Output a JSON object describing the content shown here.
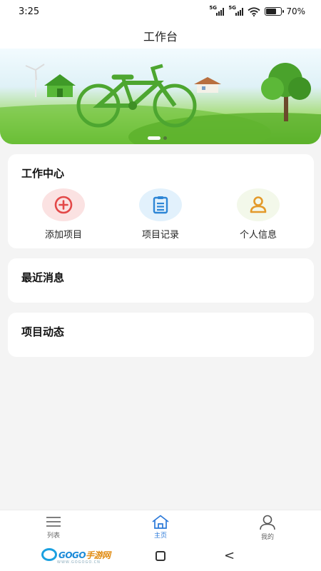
{
  "status": {
    "time": "3:25",
    "net1": "5G",
    "net2": "5G",
    "battery": "70%",
    "battery_level": 0.7
  },
  "header": {
    "title": "工作台"
  },
  "banner": {
    "slides": 2,
    "active_slide": 1
  },
  "work_center": {
    "title": "工作中心",
    "items": [
      {
        "label": "添加项目",
        "icon": "add-circle-icon",
        "bg": "#fbe2e2",
        "color": "#e34848"
      },
      {
        "label": "项目记录",
        "icon": "document-list-icon",
        "bg": "#e2f1fc",
        "color": "#2d86d6"
      },
      {
        "label": "个人信息",
        "icon": "person-icon",
        "bg": "#f3f8ea",
        "color": "#e39a2a"
      }
    ]
  },
  "recent_news": {
    "title": "最近消息"
  },
  "project_updates": {
    "title": "项目动态"
  },
  "tabbar": {
    "items": [
      {
        "label": "列表",
        "icon": "list-icon",
        "active": false
      },
      {
        "label": "主页",
        "icon": "home-icon",
        "active": true
      },
      {
        "label": "我的",
        "icon": "user-icon",
        "active": false
      }
    ],
    "active_color": "#2a78d8"
  },
  "watermark": {
    "brand_a": "GOGO",
    "brand_b": "手游网",
    "url": "WWW.GOGOGO.CN"
  }
}
